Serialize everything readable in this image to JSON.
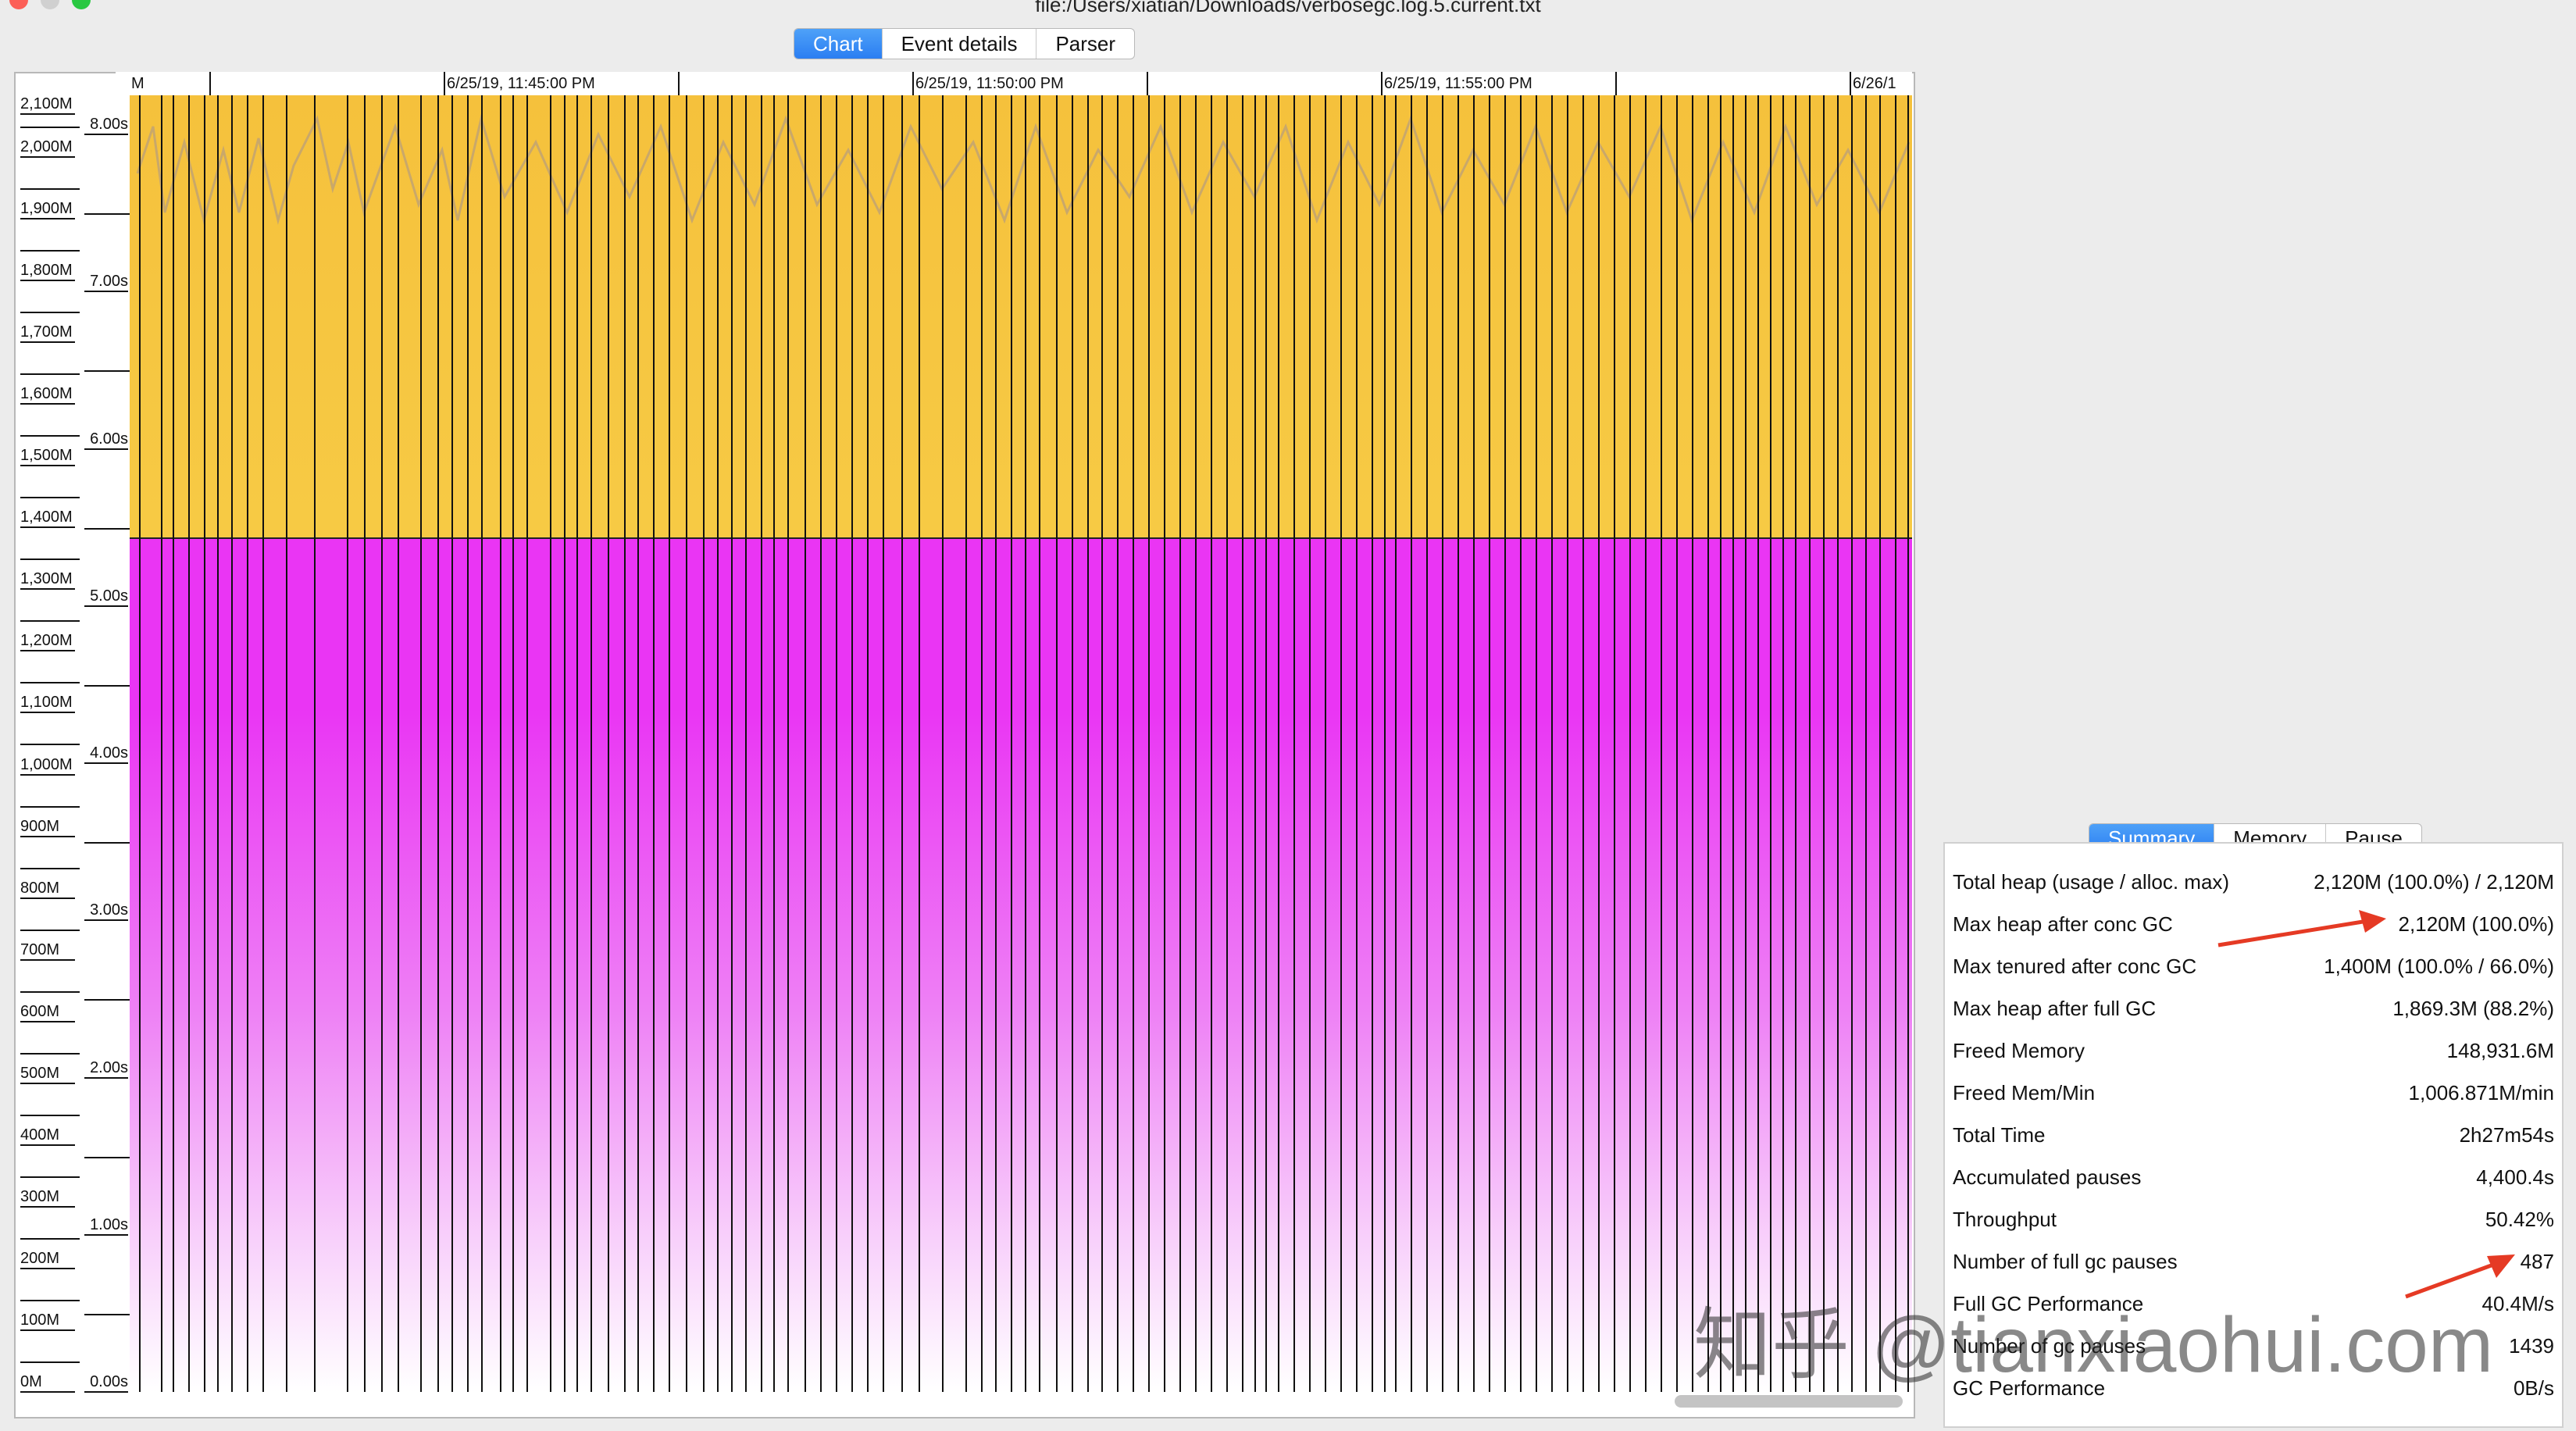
{
  "window": {
    "title": "file:/Users/xiatian/Downloads/verbosegc.log.5.current.txt"
  },
  "main_tabs": [
    {
      "label": "Chart",
      "active": true
    },
    {
      "label": "Event details",
      "active": false
    },
    {
      "label": "Parser",
      "active": false
    }
  ],
  "chart": {
    "time_labels": [
      "M",
      "6/25/19, 11:45:00 PM",
      "6/25/19, 11:50:00 PM",
      "6/25/19, 11:55:00 PM",
      "6/26/1"
    ],
    "memory_labels": [
      "2,100M",
      "2,000M",
      "1,900M",
      "1,800M",
      "1,700M",
      "1,600M",
      "1,500M",
      "1,400M",
      "1,300M",
      "1,200M",
      "1,100M",
      "1,000M",
      "900M",
      "800M",
      "700M",
      "600M",
      "500M",
      "400M",
      "300M",
      "200M",
      "100M",
      "0M"
    ],
    "pause_labels": [
      "8.00s",
      "7.00s",
      "6.00s",
      "5.00s",
      "4.00s",
      "3.00s",
      "2.00s",
      "1.00s",
      "0.00s"
    ],
    "colors": {
      "tenured": "#f5c13c",
      "young": "#ea35f4",
      "gc_event": "#111111"
    }
  },
  "summary_tabs": [
    {
      "label": "Summary",
      "active": true
    },
    {
      "label": "Memory",
      "active": false
    },
    {
      "label": "Pause",
      "active": false
    }
  ],
  "summary": [
    {
      "label": "Total heap (usage / alloc. max)",
      "value": "2,120M (100.0%) / 2,120M"
    },
    {
      "label": "Max heap after conc GC",
      "value": "2,120M (100.0%)"
    },
    {
      "label": "Max tenured after conc GC",
      "value": "1,400M (100.0% / 66.0%)"
    },
    {
      "label": "Max heap after full GC",
      "value": "1,869.3M (88.2%)"
    },
    {
      "label": "Freed Memory",
      "value": "148,931.6M"
    },
    {
      "label": "Freed Mem/Min",
      "value": "1,006.871M/min"
    },
    {
      "label": "Total Time",
      "value": "2h27m54s"
    },
    {
      "label": "Accumulated pauses",
      "value": "4,400.4s"
    },
    {
      "label": "Throughput",
      "value": "50.42%"
    },
    {
      "label": "Number of full gc pauses",
      "value": "487"
    },
    {
      "label": "Full GC Performance",
      "value": "40.4M/s"
    },
    {
      "label": "Number of gc pauses",
      "value": "1439"
    },
    {
      "label": "GC Performance",
      "value": "0B/s"
    }
  ],
  "watermark": "知乎 @tianxiaohui.com"
}
